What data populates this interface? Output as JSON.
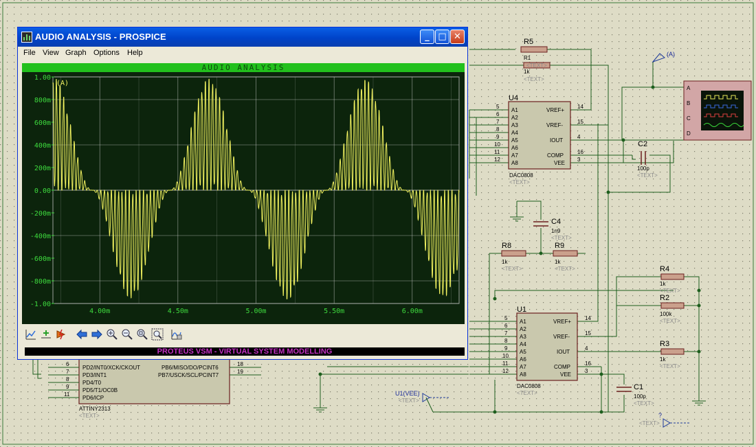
{
  "window": {
    "title": "AUDIO ANALYSIS - PROSPICE",
    "minimize_label": "_",
    "maximize_label": "□",
    "close_label": "✕",
    "menu": [
      "File",
      "View",
      "Graph",
      "Options",
      "Help"
    ]
  },
  "graph": {
    "title": "AUDIO ANALYSIS",
    "trace_label": "(A)",
    "y_ticks": [
      "1.00",
      "800m",
      "600m",
      "400m",
      "200m",
      "0.00",
      "-200m",
      "-400m",
      "-600m",
      "-800m",
      "-1.00"
    ],
    "x_ticks": [
      "4.00m",
      "4.50m",
      "5.00m",
      "5.50m",
      "6.00m"
    ],
    "trace_color": "#f2f260",
    "grid_color": "#cfcfcf",
    "background": "#0c240c",
    "title_bar_color": "#22c01d"
  },
  "chart_data": {
    "type": "line",
    "title": "AUDIO ANALYSIS",
    "xlabel": "",
    "ylabel": "",
    "xlim": [
      0.0037,
      0.0063
    ],
    "ylim": [
      -1.0,
      1.0
    ],
    "x_tick_labels": [
      "4.00m",
      "4.50m",
      "5.00m",
      "5.50m",
      "6.00m"
    ],
    "y_tick_labels": [
      "1.00",
      "800m",
      "600m",
      "400m",
      "200m",
      "0.00",
      "-200m",
      "-400m",
      "-600m",
      "-800m",
      "-1.00"
    ],
    "series": [
      {
        "name": "(A)",
        "description": "PWM-modulated sine, envelope period about 1.0m",
        "envelope_x": [
          0.0037,
          0.00395,
          0.0042,
          0.00445,
          0.0047,
          0.00495,
          0.0052,
          0.00545,
          0.0057,
          0.00595,
          0.0062,
          0.0063
        ],
        "envelope_y": [
          1.0,
          0.0,
          -0.95,
          0.0,
          0.98,
          0.0,
          -0.96,
          0.0,
          0.97,
          0.0,
          -0.95,
          -0.7
        ]
      }
    ],
    "grid": true
  },
  "toolbar": {
    "tools": [
      "graph-icon",
      "add-trace-icon",
      "simulate-icon",
      "back-arrow-icon",
      "forward-arrow-icon",
      "zoom-in-icon",
      "zoom-out-icon",
      "zoom-all-icon",
      "zoom-area-icon",
      "graph-properties-icon"
    ]
  },
  "status": {
    "text": "PROTEUS VSM - VIRTUAL SYSTEM MODELLING"
  },
  "schematic": {
    "u4_label": "U4",
    "u4_part": "DAC0808",
    "u1_label": "U1",
    "u1_part": "DAC0808",
    "text_placeholder": "<TEXT>",
    "dac_left_pins": [
      "A1",
      "A2",
      "A3",
      "A4",
      "A5",
      "A6",
      "A7",
      "A8"
    ],
    "dac_left_nums": [
      "5",
      "6",
      "7",
      "8",
      "9",
      "10",
      "11",
      "12"
    ],
    "dac_right_pins": [
      "VREF+",
      "VREF-",
      "IOUT",
      "COMP",
      "VEE"
    ],
    "dac_right_nums": [
      "14",
      "15",
      "4",
      "16",
      "3"
    ],
    "r5": "R5",
    "r5_val": "1k",
    "r1": "R1",
    "r8": "R8",
    "r8_val": "1k",
    "r9": "R9",
    "r9_val": "1k",
    "r4": "R4",
    "r4_val": "1k",
    "r2": "R2",
    "r2_val": "100k",
    "r3": "R3",
    "r3_val": "1k",
    "c1": "C1",
    "c1_val": "100p",
    "c2": "C2",
    "c2_val": "100p",
    "c4": "C4",
    "c4_val": "1n9",
    "probe_a": "(A)",
    "scope_channels": [
      "A",
      "B",
      "C",
      "D"
    ],
    "mcu_part": "ATTINY2313",
    "mcu_left_pins": [
      "PD2/INT0/XCK/CKOUT",
      "PD3/INT1",
      "PD4/T0",
      "PD5/T1/OC0B",
      "PD6/ICP"
    ],
    "mcu_left_nums": [
      "6",
      "7",
      "8",
      "9",
      "11"
    ],
    "mcu_right_pins": [
      "PB6/MISO/DO/PCINT6",
      "PB7/USCK/SCL/PCINT7"
    ],
    "mcu_right_nums": [
      "18",
      "19"
    ],
    "u1_vee": "U1(VEE)",
    "question": "?"
  }
}
